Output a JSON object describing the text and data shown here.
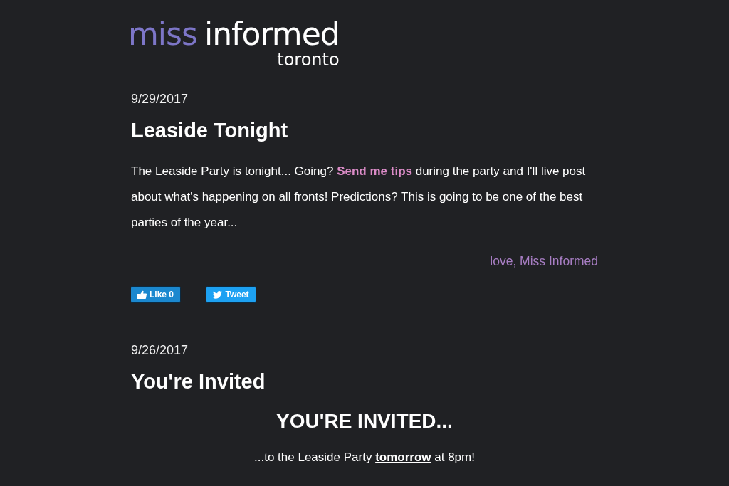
{
  "logo": {
    "parts": [
      {
        "kind": "accent",
        "text": "miss"
      },
      {
        "kind": "main",
        "text": "informed"
      }
    ],
    "subtitle": "toronto"
  },
  "posts": [
    {
      "date": "9/29/2017",
      "title": "Leaside Tonight",
      "blocks": [
        {
          "kind": "paragraph",
          "segments": [
            {
              "kind": "text",
              "text": "The Leaside Party is tonight... Going? "
            },
            {
              "kind": "link",
              "text": "Send me tips"
            },
            {
              "kind": "text",
              "text": " during the party and I'll live post about what's happening on all fronts! Predictions? This is going to be one of the best parties of the year..."
            }
          ]
        }
      ],
      "signature": "love, Miss Informed",
      "social": [
        {
          "kind": "like",
          "label": "Like 0"
        },
        {
          "kind": "tweet",
          "label": "Tweet"
        }
      ]
    },
    {
      "date": "9/26/2017",
      "title": "You're Invited",
      "blocks": [
        {
          "kind": "heading",
          "text": "YOU'RE INVITED..."
        },
        {
          "kind": "centered",
          "segments": [
            {
              "kind": "text",
              "text": "...to the Leaside Party "
            },
            {
              "kind": "underlined",
              "text": "tomorrow"
            },
            {
              "kind": "text",
              "text": " at 8pm!"
            }
          ]
        }
      ]
    }
  ]
}
